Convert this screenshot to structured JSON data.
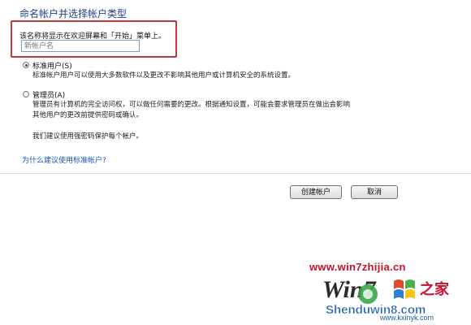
{
  "page": {
    "heading": "命名帐户并选择帐户类型",
    "hint": "该名称将显示在欢迎屏幕和「开始」菜单上。"
  },
  "account_name": {
    "value": "",
    "placeholder": "新帐户名"
  },
  "account_types": [
    {
      "label": "标准用户(S)",
      "checked": true,
      "description": [
        "标准帐户用户可以使用大多数软件以及更改不影响其他用户或计算机安全的系统设置。"
      ]
    },
    {
      "label": "管理员(A)",
      "checked": false,
      "description": [
        "管理员有计算机的完全访问权，可以做任何需要的更改。根据通知设置，可能会要求管理员在做出会影响",
        "其他用户的更改前提供密码或确认。"
      ]
    }
  ],
  "recommendation": "我们建议使用强密码保护每个帐户。",
  "help_link": "为什么建议使用标准帐户?",
  "buttons": {
    "create": "创建帐户",
    "cancel": "取消"
  },
  "watermark": {
    "site": "www.win7zhijia.cn",
    "logo_word": "Win7",
    "logo_cn": "之家",
    "logo_site": "Shenduwin8.com",
    "bottom_url": "www.kxinyk.com"
  },
  "colors": {
    "highlight_border": "#c23a3a",
    "link": "#1a56b0",
    "heading": "#1e3f8a",
    "watermark_red": "#c8102e"
  }
}
